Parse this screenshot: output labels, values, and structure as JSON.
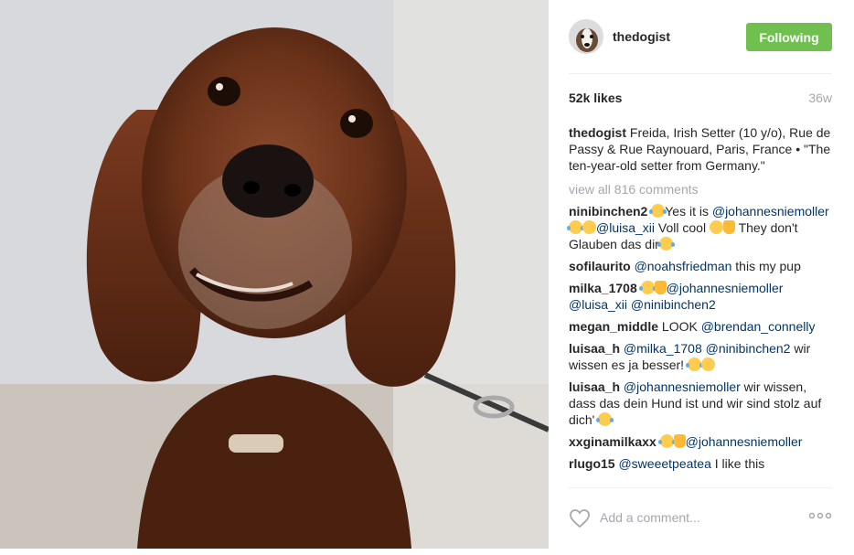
{
  "post": {
    "username": "thedogist",
    "follow_label": "Following",
    "likes": "52k likes",
    "age": "36w",
    "caption_user": "thedogist",
    "caption_text": "Freida, Irish Setter (10 y/o), Rue de Passy & Rue Raynouard, Paris, France • \"The ten-year-old setter from Germany.\"",
    "view_all": "view all 816 comments",
    "add_comment_placeholder": "Add a comment..."
  },
  "comments": [
    {
      "user": "ninibinchen2",
      "t1": "Yes it is",
      "m1": "@johannesniemoller",
      "m2": "@luisa_xii",
      "t2": " Voll cool ",
      "t3": "They don't Glauben das dir"
    },
    {
      "user": "sofilaurito",
      "m1": "@noahsfriedman",
      "t1": " this my pup"
    },
    {
      "user": "milka_1708",
      "m1": "@johannesniemoller",
      "m2": "@luisa_xii",
      "m3": "@ninibinchen2"
    },
    {
      "user": "megan_middle",
      "t1": "LOOK ",
      "m1": "@brendan_connelly"
    },
    {
      "user": "luisaa_h",
      "m1": "@milka_1708",
      "m2": "@ninibinchen2",
      "t1": " wir wissen es ja besser! "
    },
    {
      "user": "luisaa_h",
      "m1": "@johannesniemoller",
      "t1": " wir wissen, dass das dein Hund ist und wir sind stolz auf dich' "
    },
    {
      "user": "xxginamilkaxx",
      "m1": "@johannesniemoller"
    },
    {
      "user": "rlugo15",
      "m1": "@sweeetpeatea",
      "t1": " I like this"
    }
  ],
  "icons": {
    "heart": "heart-outline-icon",
    "more": "more-dots-icon",
    "emoji_laugh": "tears-of-joy-emoji",
    "emoji_kiss": "kiss-emoji",
    "emoji_smile": "smile-emoji",
    "emoji_thumb": "thumbs-up-emoji"
  },
  "colors": {
    "follow_button": "#70c050",
    "mention": "#003569",
    "muted": "#a5a7aa"
  }
}
